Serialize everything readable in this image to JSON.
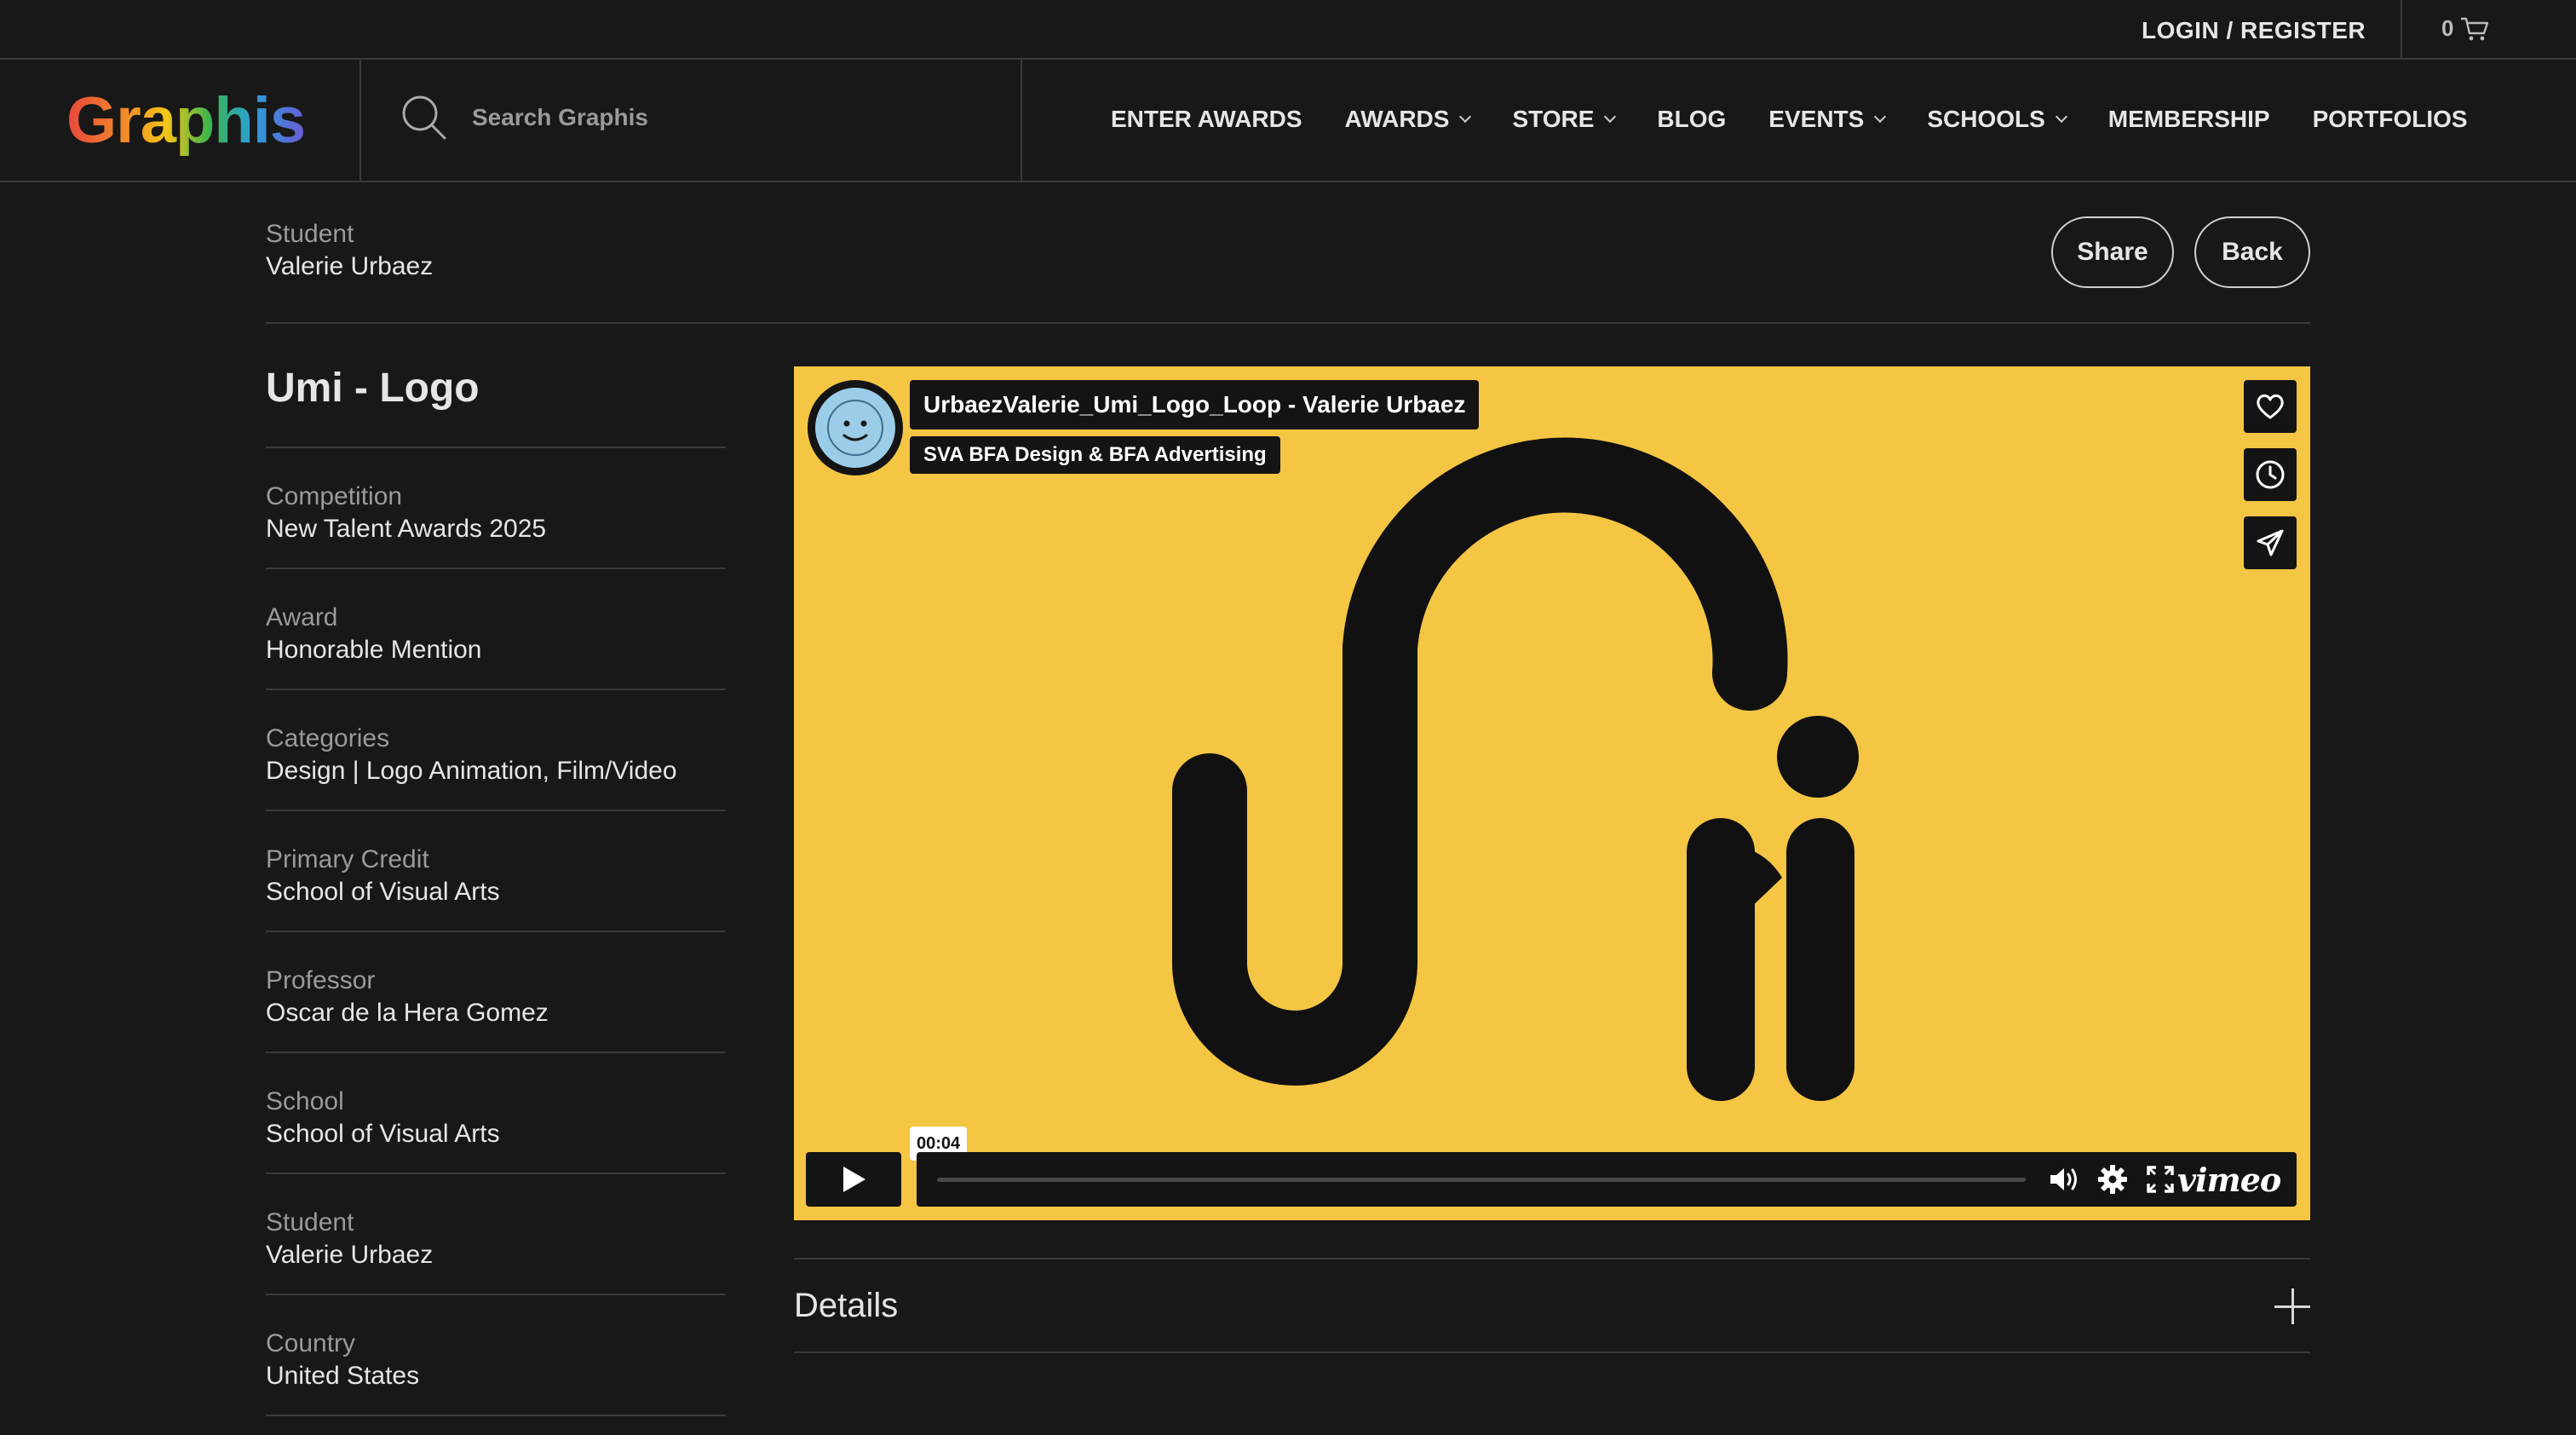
{
  "topbar": {
    "login": "LOGIN / REGISTER",
    "cart_count": "0"
  },
  "brand": {
    "logo": "Graphis"
  },
  "search": {
    "placeholder": "Search Graphis"
  },
  "nav": {
    "items": [
      {
        "label": "ENTER AWARDS",
        "dropdown": false
      },
      {
        "label": "AWARDS",
        "dropdown": true
      },
      {
        "label": "STORE",
        "dropdown": true
      },
      {
        "label": "BLOG",
        "dropdown": false
      },
      {
        "label": "EVENTS",
        "dropdown": true
      },
      {
        "label": "SCHOOLS",
        "dropdown": true
      },
      {
        "label": "MEMBERSHIP",
        "dropdown": false
      },
      {
        "label": "PORTFOLIOS",
        "dropdown": false
      }
    ]
  },
  "header": {
    "label": "Student",
    "value": "Valerie Urbaez",
    "share": "Share",
    "back": "Back"
  },
  "entry": {
    "title": "Umi - Logo",
    "info": [
      {
        "label": "Competition",
        "value": "New Talent Awards 2025"
      },
      {
        "label": "Award",
        "value": "Honorable Mention"
      },
      {
        "label": "Categories",
        "value": "Design | Logo Animation, Film/Video"
      },
      {
        "label": "Primary Credit",
        "value": "School of Visual Arts"
      },
      {
        "label": "Professor",
        "value": "Oscar de la Hera Gomez"
      },
      {
        "label": "School",
        "value": "School of Visual Arts"
      },
      {
        "label": "Student",
        "value": "Valerie Urbaez"
      },
      {
        "label": "Country",
        "value": "United States"
      }
    ]
  },
  "video": {
    "title": "UrbaezValerie_Umi_Logo_Loop - Valerie Urbaez",
    "channel": "SVA BFA Design & BFA Advertising",
    "time": "00:04",
    "progress": 0.0,
    "brand": "vimeo",
    "background": "#f5c544"
  },
  "details": {
    "label": "Details"
  }
}
